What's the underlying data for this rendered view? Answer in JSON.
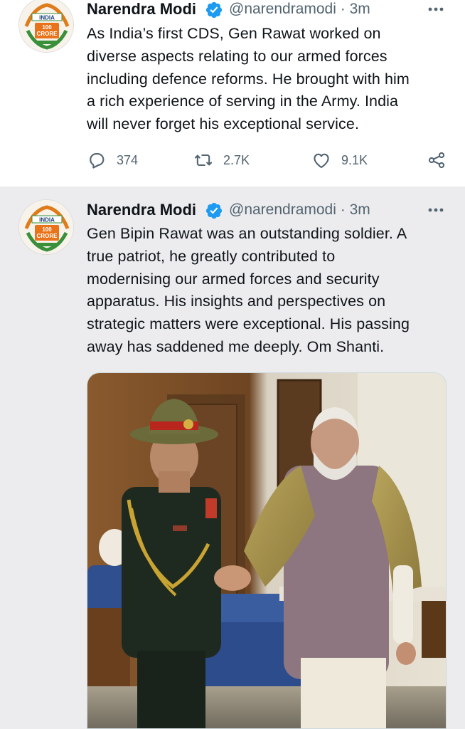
{
  "tweets": [
    {
      "author_name": "Narendra Modi",
      "handle": "@narendramodi",
      "dot": "·",
      "time": "3m",
      "avatar_text": [
        "INDIA",
        "100",
        "CRORE"
      ],
      "text_lines": [
        "As India’s first CDS, Gen Rawat worked on",
        "diverse aspects relating to our armed forces",
        "including defence reforms. He brought with him",
        "a rich experience of serving in the Army. India",
        "will never forget his exceptional service."
      ],
      "reply_count": "374",
      "retweet_count": "2.7K",
      "like_count": "9.1K"
    },
    {
      "author_name": "Narendra Modi",
      "handle": "@narendramodi",
      "dot": "·",
      "time": "3m",
      "avatar_text": [
        "INDIA",
        "100",
        "CRORE"
      ],
      "text_lines": [
        "Gen Bipin Rawat was an outstanding soldier. A",
        "true patriot, he greatly contributed to",
        "modernising our armed forces and security",
        "apparatus. His insights and perspectives on",
        "strategic matters were exceptional. His passing",
        "away has saddened me deeply. Om Shanti."
      ]
    }
  ],
  "icons": {
    "verified": "verified-badge-icon",
    "more": "more-options-icon",
    "reply": "reply-icon",
    "retweet": "retweet-icon",
    "like": "like-icon",
    "share": "share-icon"
  },
  "colors": {
    "verified_blue": "#1d9bf0",
    "secondary_text": "#536471",
    "highlight_bg": "#ececee"
  }
}
